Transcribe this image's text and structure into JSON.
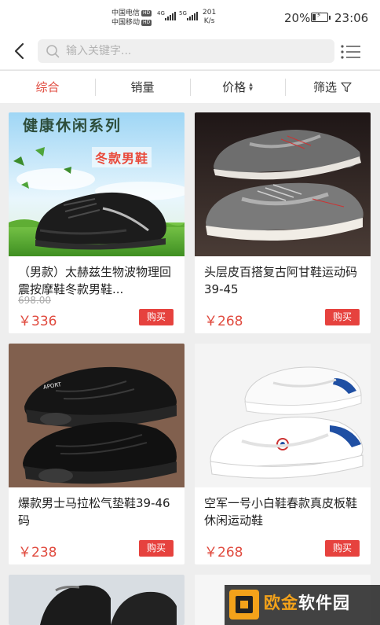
{
  "status_bar": {
    "carrier_1": "中国电信",
    "carrier_2": "中国移动",
    "hd_1": "HD",
    "hd_2": "HD",
    "net_1": "4G",
    "net_2": "5G",
    "speed_value": "201",
    "speed_unit": "K/s",
    "battery_percent": "20%",
    "battery_level": 0.2,
    "time": "23:06"
  },
  "header": {
    "search_placeholder": "输入关键字...",
    "search_value": ""
  },
  "sort_tabs": [
    {
      "label": "综合",
      "active": true
    },
    {
      "label": "销量",
      "active": false
    },
    {
      "label": "价格",
      "active": false
    },
    {
      "label": "筛选",
      "active": false
    }
  ],
  "products": [
    {
      "title": "（男款）太赫兹生物波物理回震按摩鞋冬款男鞋...",
      "old_price": "698.00",
      "price": "￥336",
      "buy_label": "购买",
      "banner_title": "健康休闲系列",
      "banner_tag": "冬款男鞋"
    },
    {
      "title": "头层皮百搭复古阿甘鞋运动码39-45",
      "old_price": "",
      "price": "￥268",
      "buy_label": "购买"
    },
    {
      "title": "爆款男士马拉松气垫鞋39-46码",
      "old_price": "",
      "price": "￥238",
      "buy_label": "购买",
      "shoe_brand_text": "APORT"
    },
    {
      "title": "空军一号小白鞋春款真皮板鞋休闲运动鞋",
      "old_price": "",
      "price": "￥268",
      "buy_label": "购买"
    }
  ],
  "watermark": {
    "text_1": "欧金",
    "text_2": "软件园"
  },
  "colors": {
    "accent": "#e04a3e",
    "buy_button": "#e6423e",
    "background": "#eeeeee"
  }
}
